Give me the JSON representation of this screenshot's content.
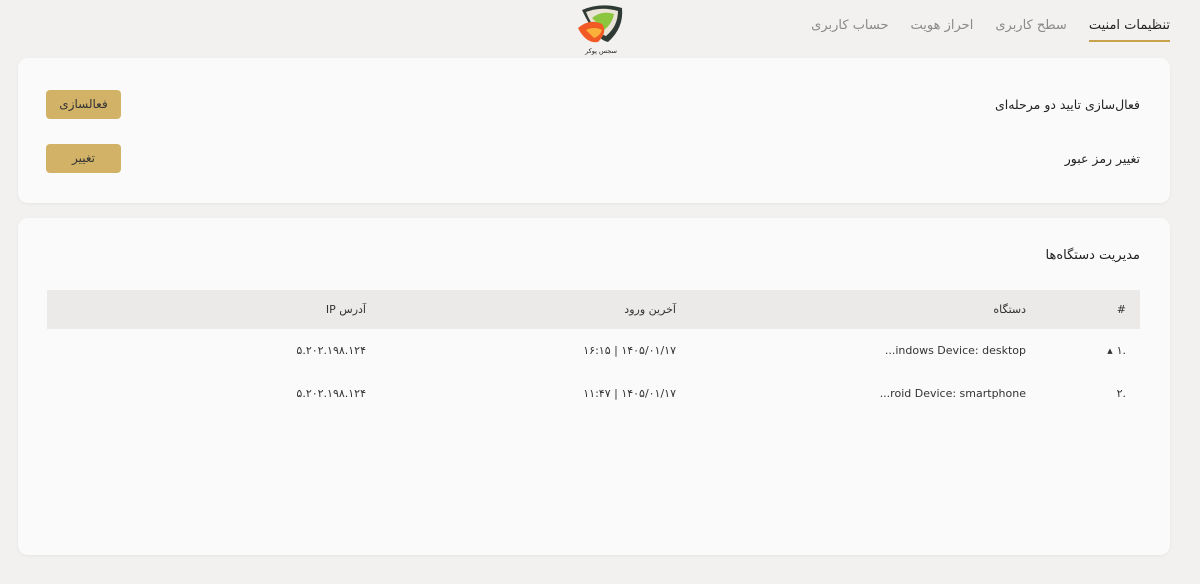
{
  "nav": {
    "tabs": [
      {
        "label": "حساب کاربری",
        "active": false
      },
      {
        "label": "احراز هویت",
        "active": false
      },
      {
        "label": "سطح کاربری",
        "active": false
      },
      {
        "label": "تنظیمات امنیت",
        "active": true
      }
    ],
    "logo_text": "سجس پوکر"
  },
  "security": {
    "two_factor_label": "فعال‌سازی تایید دو مرحله‌ای",
    "two_factor_button": "فعالسازی",
    "password_label": "تغییر رمز عبور",
    "password_button": "تغییر"
  },
  "devices": {
    "title": "مدیریت دستگاه‌ها",
    "columns": [
      "#",
      "دستگاه",
      "آخرین ورود",
      "آدرس IP"
    ],
    "rows": [
      {
        "num": ".۱",
        "device": "...indows Device: desktop",
        "last_login": "۱۴۰۵/۰۱/۱۷ | ۱۶:۱۵",
        "ip": "۵.۲۰۲.۱۹۸.۱۲۴"
      },
      {
        "num": ".۲",
        "device": "...roid Device: smartphone",
        "last_login": "۱۴۰۵/۰۱/۱۷ | ۱۱:۴۷",
        "ip": "۵.۲۰۲.۱۹۸.۱۲۴"
      }
    ]
  },
  "colors": {
    "accent": "#d2b266",
    "active_underline": "#c8a24d",
    "background": "#f2f1ef",
    "card": "#fafafa",
    "table_header": "#ebeae8"
  }
}
